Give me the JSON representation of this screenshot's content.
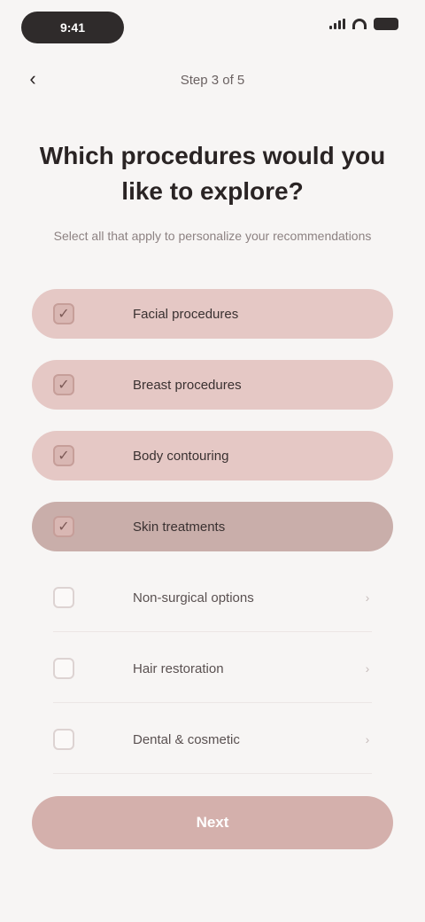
{
  "status_bar": {
    "time": "9:41"
  },
  "nav": {
    "back_icon": "chevron-left-icon",
    "title": "Step 3 of 5"
  },
  "question": "Which procedures would you like to explore?",
  "help_text": "Select all that apply to personalize your recommendations",
  "options": [
    {
      "label": "Facial procedures",
      "state": "selected"
    },
    {
      "label": "Breast procedures",
      "state": "selected"
    },
    {
      "label": "Body contouring",
      "state": "selected"
    },
    {
      "label": "Skin treatments",
      "state": "active"
    },
    {
      "label": "Non-surgical options",
      "state": "plain"
    },
    {
      "label": "Hair restoration",
      "state": "plain"
    },
    {
      "label": "Dental & cosmetic",
      "state": "plain"
    }
  ],
  "cta_label": "Next",
  "colors": {
    "background": "#f7f5f4",
    "selected": "#e5c8c5",
    "active": "#c9aeaa",
    "cta": "#d4b0ac"
  }
}
